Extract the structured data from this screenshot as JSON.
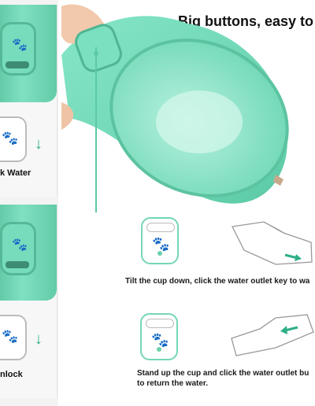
{
  "header": {
    "title": "Big buttons, easy to"
  },
  "left_panels": [
    {
      "label": "k Water",
      "arrow": "↓"
    },
    {
      "label": "nlock",
      "arrow": "↓"
    }
  ],
  "steps": [
    {
      "text": "Tilt the cup down, click the water outlet key to wa"
    },
    {
      "text_line1": "Stand up the cup and click the water outlet bu",
      "text_line2": "to return the water."
    }
  ],
  "icons": {
    "paw": "🐾",
    "arrow": "➜"
  },
  "colors": {
    "mint": "#6fd8b7",
    "arrow_green": "#2eaf88"
  }
}
